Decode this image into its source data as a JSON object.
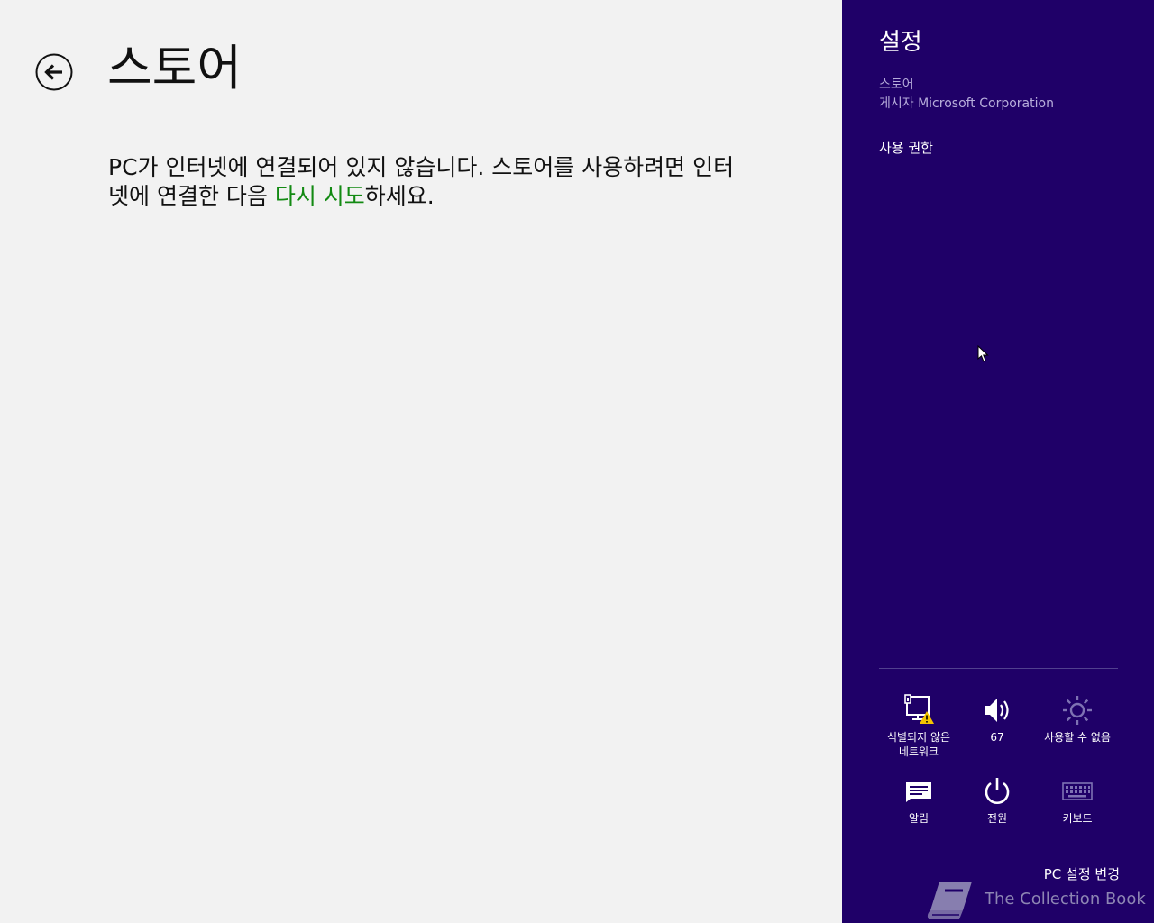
{
  "main": {
    "title": "스토어",
    "message_line1": "PC가 인터넷에 연결되어 있지 않습니다. 스토어를 사용하려면 인터",
    "message_line2_pre": "넷에 연결한 다음 ",
    "retry_link": "다시 시도",
    "message_line2_post": "하세요."
  },
  "charm": {
    "title": "설정",
    "app_name": "스토어",
    "publisher": "게시자 Microsoft Corporation",
    "permissions_link": "사용 권한",
    "quick_settings": [
      {
        "icon": "network-warning-icon",
        "label_line1": "식별되지 않은",
        "label_line2": "네트워크"
      },
      {
        "icon": "volume-icon",
        "label": "67"
      },
      {
        "icon": "brightness-icon",
        "label": "사용할 수 없음"
      },
      {
        "icon": "notifications-icon",
        "label": "알림"
      },
      {
        "icon": "power-icon",
        "label": "전원"
      },
      {
        "icon": "keyboard-icon",
        "label": "키보드"
      }
    ],
    "pc_settings_link": "PC 설정 변경"
  },
  "watermark": {
    "text": "The Collection Book",
    "icon": "book-icon"
  },
  "colors": {
    "charm_background": "#1f0068",
    "page_background": "#f2f2f2",
    "link_green": "#138a13",
    "warning_yellow": "#f5c400"
  }
}
